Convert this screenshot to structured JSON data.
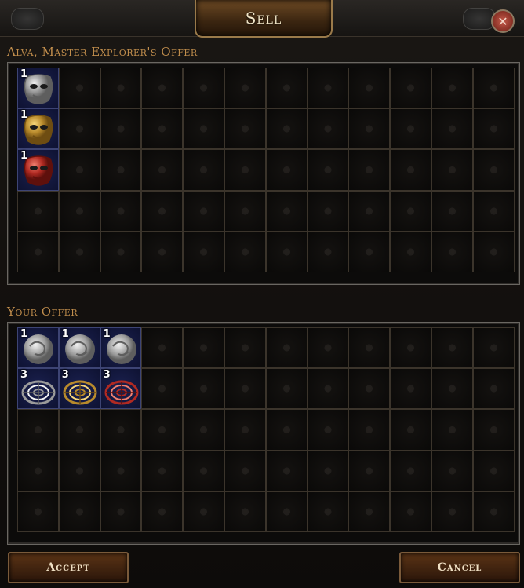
{
  "window": {
    "title": "Sell",
    "close_symbol": "✕"
  },
  "npc_offer": {
    "label": "Alva, Master Explorer's Offer",
    "cols": 12,
    "rows": 5,
    "items": [
      {
        "row": 0,
        "col": 0,
        "stack": "1",
        "icon": "silver-mask-fragment-icon",
        "tint": "silver"
      },
      {
        "row": 1,
        "col": 0,
        "stack": "1",
        "icon": "gold-mask-fragment-icon",
        "tint": "gold"
      },
      {
        "row": 2,
        "col": 0,
        "stack": "1",
        "icon": "red-mask-fragment-icon",
        "tint": "red"
      }
    ]
  },
  "your_offer": {
    "label": "Your Offer",
    "cols": 12,
    "rows": 5,
    "items": [
      {
        "row": 0,
        "col": 0,
        "stack": "1",
        "icon": "silver-orb-icon",
        "tint": "silver"
      },
      {
        "row": 0,
        "col": 1,
        "stack": "1",
        "icon": "silver-orb-icon",
        "tint": "silver"
      },
      {
        "row": 0,
        "col": 2,
        "stack": "1",
        "icon": "silver-orb-icon",
        "tint": "silver"
      },
      {
        "row": 1,
        "col": 0,
        "stack": "3",
        "icon": "silver-ring-icon",
        "tint": "silver"
      },
      {
        "row": 1,
        "col": 1,
        "stack": "3",
        "icon": "gold-ring-icon",
        "tint": "gold"
      },
      {
        "row": 1,
        "col": 2,
        "stack": "3",
        "icon": "red-ring-icon",
        "tint": "red"
      }
    ]
  },
  "buttons": {
    "accept": "Accept",
    "cancel": "Cancel"
  },
  "colors": {
    "label": "#c08d4c",
    "accent_gold": "#9a7a4a",
    "slot_filled": "#1b2150"
  }
}
